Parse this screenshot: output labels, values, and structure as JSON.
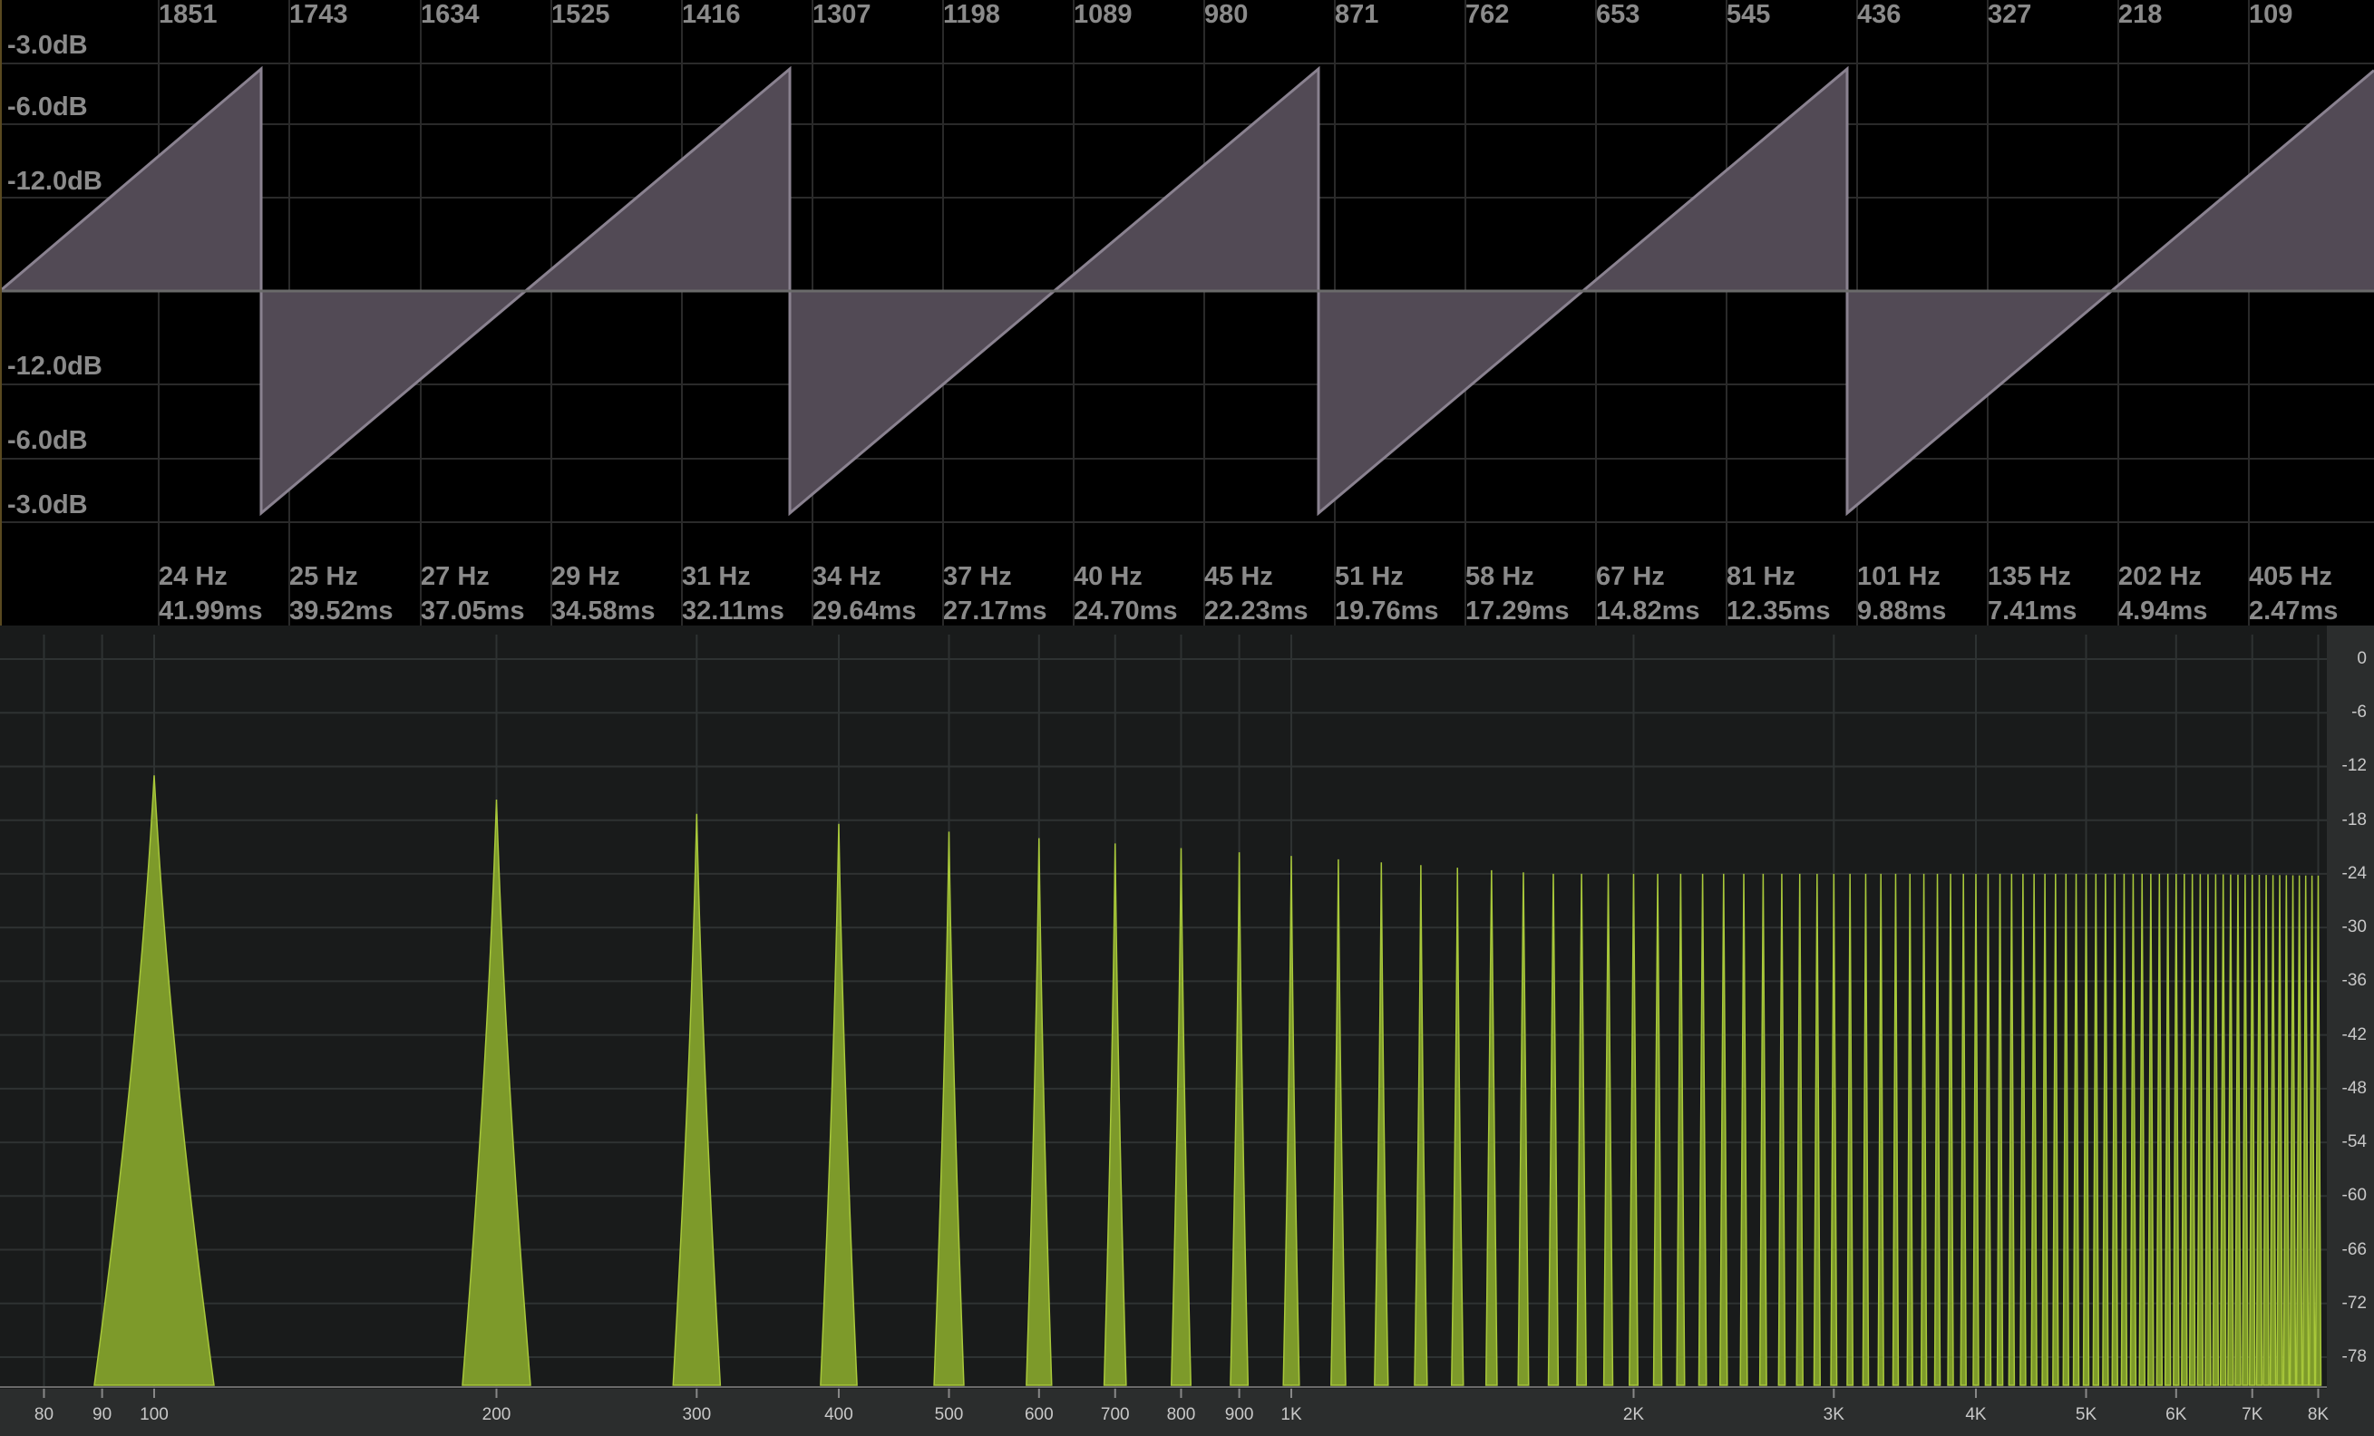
{
  "oscilloscope": {
    "db_labels_top": [
      "-3.0dB",
      "-6.0dB",
      "-12.0dB"
    ],
    "db_labels_bottom": [
      "-12.0dB",
      "-6.0dB",
      "-3.0dB"
    ],
    "sample_labels": [
      "1851",
      "1743",
      "1634",
      "1525",
      "1416",
      "1307",
      "1198",
      "1089",
      "980",
      "871",
      "762",
      "653",
      "545",
      "436",
      "327",
      "218",
      "109"
    ],
    "hz_labels": [
      "24 Hz",
      "25 Hz",
      "27 Hz",
      "29 Hz",
      "31 Hz",
      "34 Hz",
      "37 Hz",
      "40 Hz",
      "45 Hz",
      "51 Hz",
      "58 Hz",
      "67 Hz",
      "81 Hz",
      "101 Hz",
      "135 Hz",
      "202 Hz",
      "405 Hz"
    ],
    "ms_labels": [
      "41.99ms",
      "39.52ms",
      "37.05ms",
      "34.58ms",
      "32.11ms",
      "29.64ms",
      "27.17ms",
      "24.70ms",
      "22.23ms",
      "19.76ms",
      "17.29ms",
      "14.82ms",
      "12.35ms",
      "9.88ms",
      "7.41ms",
      "4.94ms",
      "2.47ms"
    ],
    "waveform": "sawtooth",
    "colors": {
      "wave_fill": "#524a55",
      "wave_edge": "#8a8290",
      "grid": "#2a2a2a",
      "center_line": "#6a6a6a"
    }
  },
  "spectrum": {
    "freq_labels": [
      "80",
      "90",
      "100",
      "200",
      "300",
      "400",
      "500",
      "600",
      "700",
      "800",
      "900",
      "1K",
      "2K",
      "3K",
      "4K",
      "5K",
      "6K",
      "7K",
      "8K"
    ],
    "level_labels": [
      "0",
      "-6",
      "-12",
      "-18",
      "-24",
      "-30",
      "-36",
      "-42",
      "-48",
      "-54",
      "-60",
      "-66",
      "-72",
      "-78"
    ],
    "fundamental_hz": 100,
    "colors": {
      "peak_fill": "#7d9a2a",
      "peak_edge": "#a8c83a",
      "background": "#191b1b",
      "grid": "#2e3232"
    }
  }
}
